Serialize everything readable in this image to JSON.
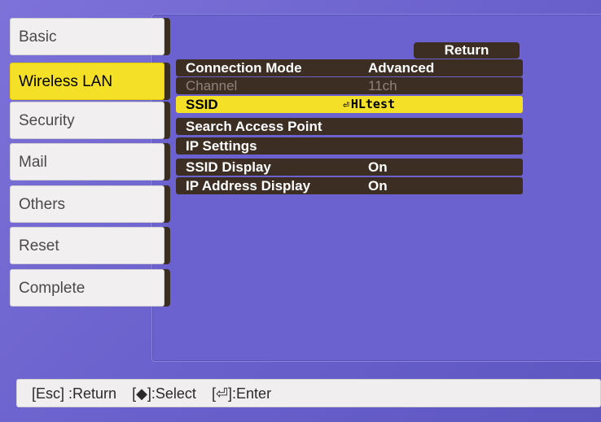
{
  "tabs": [
    {
      "label": "Basic"
    },
    {
      "label": "Wireless LAN"
    },
    {
      "label": "Security"
    },
    {
      "label": "Mail"
    },
    {
      "label": "Others"
    },
    {
      "label": "Reset"
    },
    {
      "label": "Complete"
    }
  ],
  "return_label": "Return",
  "rows": [
    {
      "label": "Connection Mode",
      "value": "Advanced",
      "state": "normal"
    },
    {
      "label": "Channel",
      "value": "11ch",
      "state": "disabled"
    },
    {
      "label": "SSID",
      "value": "HLtest",
      "state": "selected"
    },
    {
      "label": "Search Access Point",
      "value": "",
      "state": "normal"
    },
    {
      "label": "IP Settings",
      "value": "",
      "state": "normal"
    },
    {
      "label": "SSID Display",
      "value": "On",
      "state": "normal"
    },
    {
      "label": "IP Address Display",
      "value": "On",
      "state": "normal"
    }
  ],
  "footer": {
    "esc": "[Esc] :Return",
    "select": "[◆]:Select",
    "enter": "[⏎]:Enter"
  },
  "colors": {
    "background": "#6b62cf",
    "row": "#3c2e23",
    "highlight": "#f5e028",
    "tab": "#f1efef"
  }
}
